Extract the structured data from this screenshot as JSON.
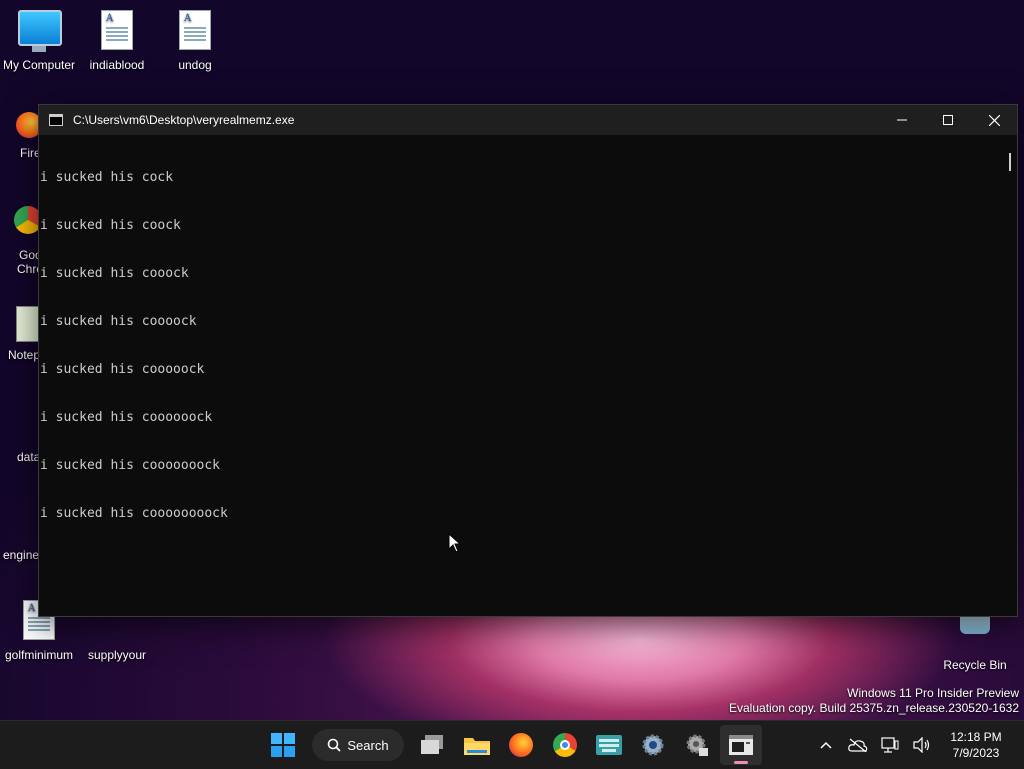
{
  "desktop": {
    "icons_top": [
      {
        "label": "My Computer"
      },
      {
        "label": "indiablood"
      },
      {
        "label": "undog"
      }
    ],
    "icons_left_partial": [
      {
        "label": "Fire"
      },
      {
        "label": "Goo"
      },
      {
        "label": "Chro"
      },
      {
        "label": "Notep"
      },
      {
        "label": "data"
      },
      {
        "label": "engine"
      }
    ],
    "icons_bottom": [
      {
        "label": "golfminimum"
      },
      {
        "label": "supplyyour"
      },
      {
        "label": "Recycle Bin"
      }
    ]
  },
  "console": {
    "title": "C:\\Users\\vm6\\Desktop\\veryrealmemz.exe",
    "lines": [
      "i sucked his cock",
      "i sucked his coock",
      "i sucked his cooock",
      "i sucked his coooock",
      "i sucked his cooooock",
      "i sucked his coooooock",
      "i sucked his cooooooock",
      "i sucked his coooooooock"
    ]
  },
  "watermark": {
    "line1": "Windows 11 Pro Insider Preview",
    "line2": "Evaluation copy. Build 25375.zn_release.230520-1632"
  },
  "taskbar": {
    "search_label": "Search",
    "time": "12:18 PM",
    "date": "7/9/2023"
  },
  "colors": {
    "console_bg": "#0c0c0c",
    "console_text": "#cccccc",
    "titlebar": "#1f1f1f",
    "taskbar": "#1c1c1c",
    "accent_indicator": "#f08cb8"
  }
}
